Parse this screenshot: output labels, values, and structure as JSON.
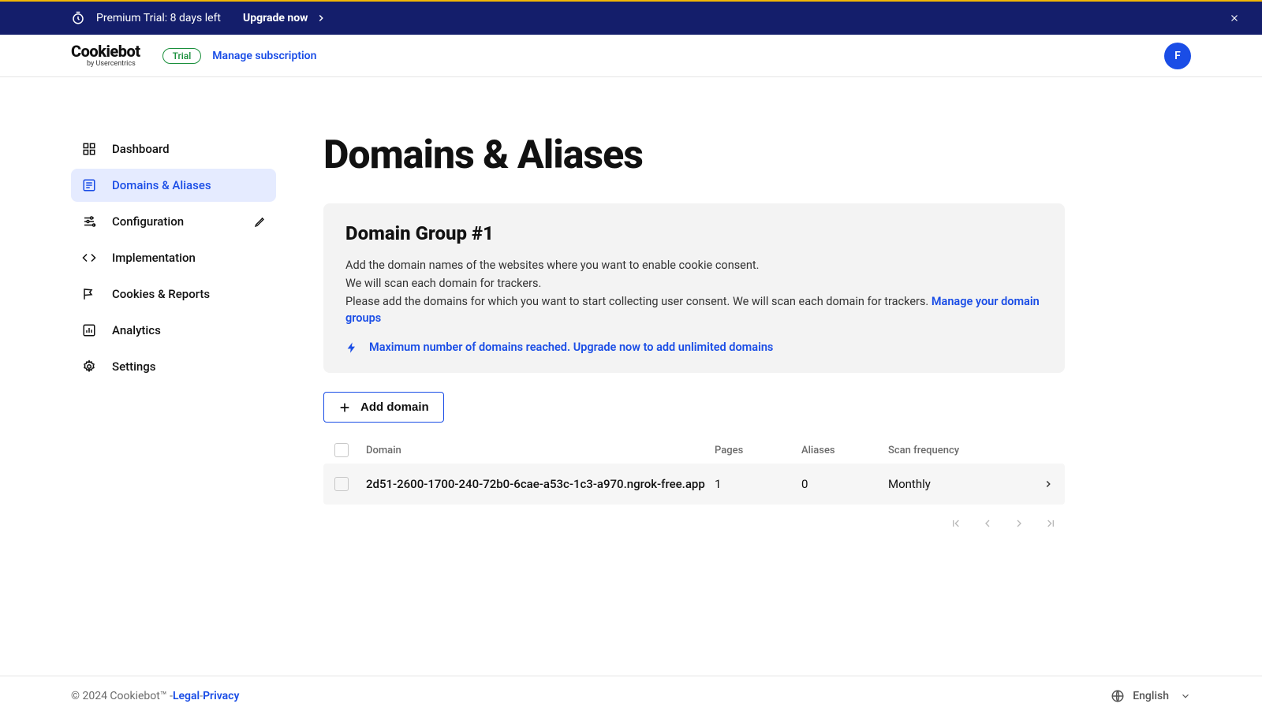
{
  "banner": {
    "trial_text": "Premium Trial: 8 days left",
    "upgrade_label": "Upgrade now"
  },
  "header": {
    "logo_main": "Cookiebot",
    "logo_sub": "by Usercentrics",
    "trial_pill": "Trial",
    "manage_sub": "Manage subscription",
    "avatar_letter": "F"
  },
  "sidebar": {
    "items": [
      {
        "label": "Dashboard"
      },
      {
        "label": "Domains & Aliases"
      },
      {
        "label": "Configuration"
      },
      {
        "label": "Implementation"
      },
      {
        "label": "Cookies & Reports"
      },
      {
        "label": "Analytics"
      },
      {
        "label": "Settings"
      }
    ]
  },
  "page": {
    "title": "Domains & Aliases",
    "group_title": "Domain Group #1",
    "desc_line1": "Add the domain names of the websites where you want to enable cookie consent.",
    "desc_line2": "We will scan each domain for trackers.",
    "desc_line3a": "Please add the domains for which you want to start collecting user consent. We will scan each domain for trackers. ",
    "manage_groups_link": "Manage your domain groups",
    "upgrade_notice": "Maximum number of domains reached. Upgrade now to add unlimited domains",
    "add_domain_label": "Add domain"
  },
  "table": {
    "headers": {
      "domain": "Domain",
      "pages": "Pages",
      "aliases": "Aliases",
      "scan": "Scan frequency"
    },
    "row": {
      "domain": "2d51-2600-1700-240-72b0-6cae-a53c-1c3-a970.ngrok-free.app",
      "pages": "1",
      "aliases": "0",
      "scan": "Monthly"
    }
  },
  "footer": {
    "copyright": "© 2024 Cookiebot™ - ",
    "legal": "Legal",
    "sep": " - ",
    "privacy": "Privacy",
    "language": "English"
  }
}
